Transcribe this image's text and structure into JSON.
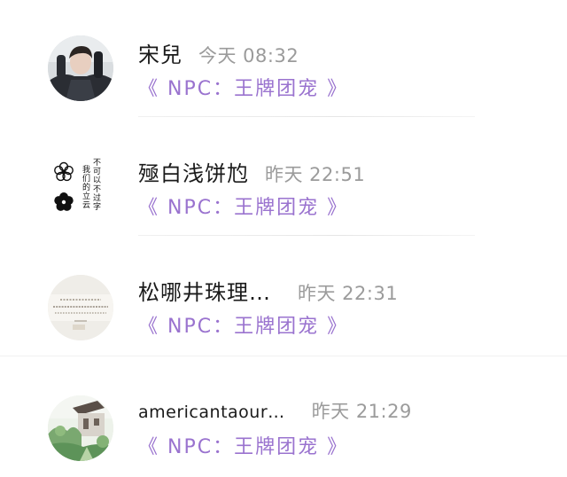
{
  "contacts": [
    {
      "name": "宋兒",
      "time": "今天 08:32",
      "subtitle": "《 NPC：王牌团宠 》"
    },
    {
      "name": "殛白浅饼尥",
      "time": "昨天 22:51",
      "subtitle": "《 NPC：王牌团宠 》",
      "avatar_text": [
        "不可以不过字",
        "我们的立云"
      ]
    },
    {
      "name": "松哪井珠理…",
      "time": "昨天 22:31",
      "subtitle": "《 NPC：王牌团宠 》"
    },
    {
      "name": "americantaour…",
      "time": "昨天 21:29",
      "subtitle": "《 NPC：王牌团宠 》"
    }
  ],
  "colors": {
    "name": "#1a1a1a",
    "time": "#9b9b9b",
    "subtitle": "#9a73cf",
    "background": "#ffffff"
  },
  "icons": [
    "portrait-avatar",
    "flower-text-avatar",
    "text-card-avatar",
    "landscape-house-avatar"
  ]
}
